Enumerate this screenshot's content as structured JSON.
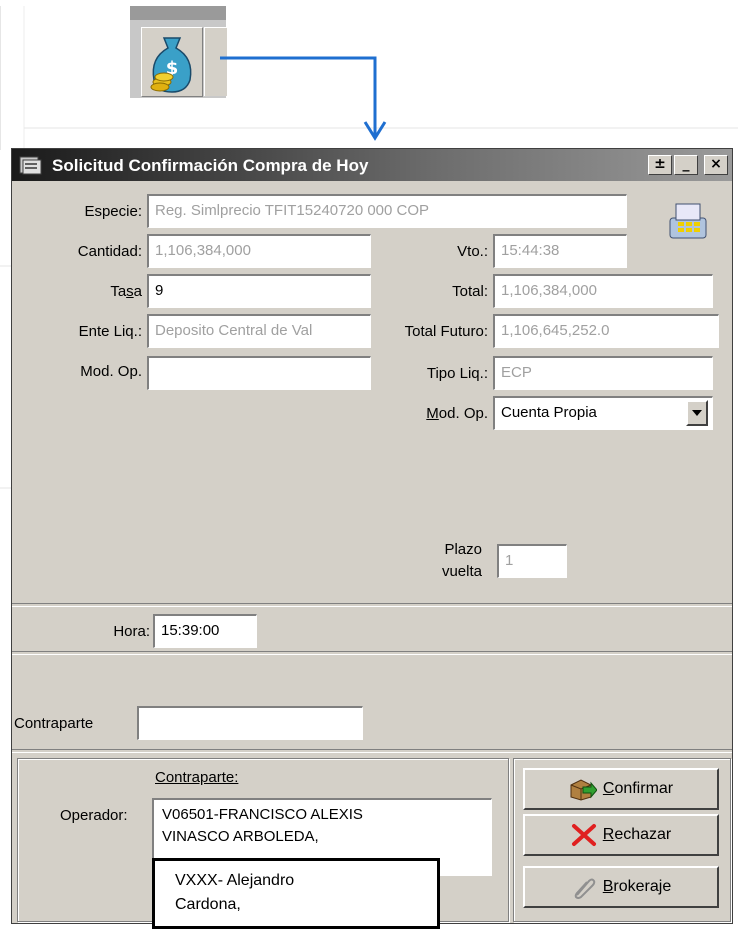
{
  "toolbar": {
    "money_icon": "money-bag-icon"
  },
  "window": {
    "title": "Solicitud Confirmación Compra de Hoy",
    "controls": [
      "±",
      "_",
      "×"
    ]
  },
  "form": {
    "especie": {
      "label": "Especie:",
      "value": "Reg. Simlprecio TFIT15240720 000 COP"
    },
    "cantidad": {
      "label": "Cantidad:",
      "value": "1,106,384,000"
    },
    "vto": {
      "label": "Vto.:",
      "value": "15:44:38"
    },
    "tasa": {
      "label_pre": "Ta",
      "label_key": "s",
      "label_post": "a",
      "value": "9"
    },
    "total": {
      "label": "Total:",
      "value": "1,106,384,000"
    },
    "ente_liq": {
      "label": "Ente Liq.:",
      "value": "Deposito Central de Val"
    },
    "total_futuro": {
      "label": "Total Futuro:",
      "value": "1,106,645,252.0"
    },
    "mod_op_left": {
      "label": "Mod. Op.",
      "value": ""
    },
    "tipo_liq": {
      "label": "Tipo Liq.:",
      "value": "ECP"
    },
    "mod_op_right": {
      "label_key": "M",
      "label_rest": "od. Op.",
      "value": "Cuenta Propia"
    },
    "plazo_vuelta": {
      "label1": "Plazo",
      "label2": "vuelta",
      "value": "1"
    },
    "hora": {
      "label": "Hora:",
      "value": "15:39:00"
    },
    "contraparte": {
      "label": "Contraparte",
      "value": ""
    }
  },
  "bottom": {
    "contraparte_header": "Contraparte:",
    "operador_label": "Operador:",
    "operador_line1": "V06501-FRANCISCO ALEXIS",
    "operador_line2": "VINASCO ARBOLEDA,"
  },
  "buttons": {
    "confirmar": {
      "key": "C",
      "rest": "onfirmar"
    },
    "rechazar": {
      "key": "R",
      "rest": "echazar"
    },
    "brokeraje": {
      "key": "B",
      "rest": "rokeraje"
    }
  },
  "callout": {
    "line1": "VXXX- Alejandro",
    "line2": "Cardona,"
  },
  "colors": {
    "arrow": "#1f6fd0",
    "title_dark": "#1a1a1a",
    "face": "#d4d0c8"
  }
}
